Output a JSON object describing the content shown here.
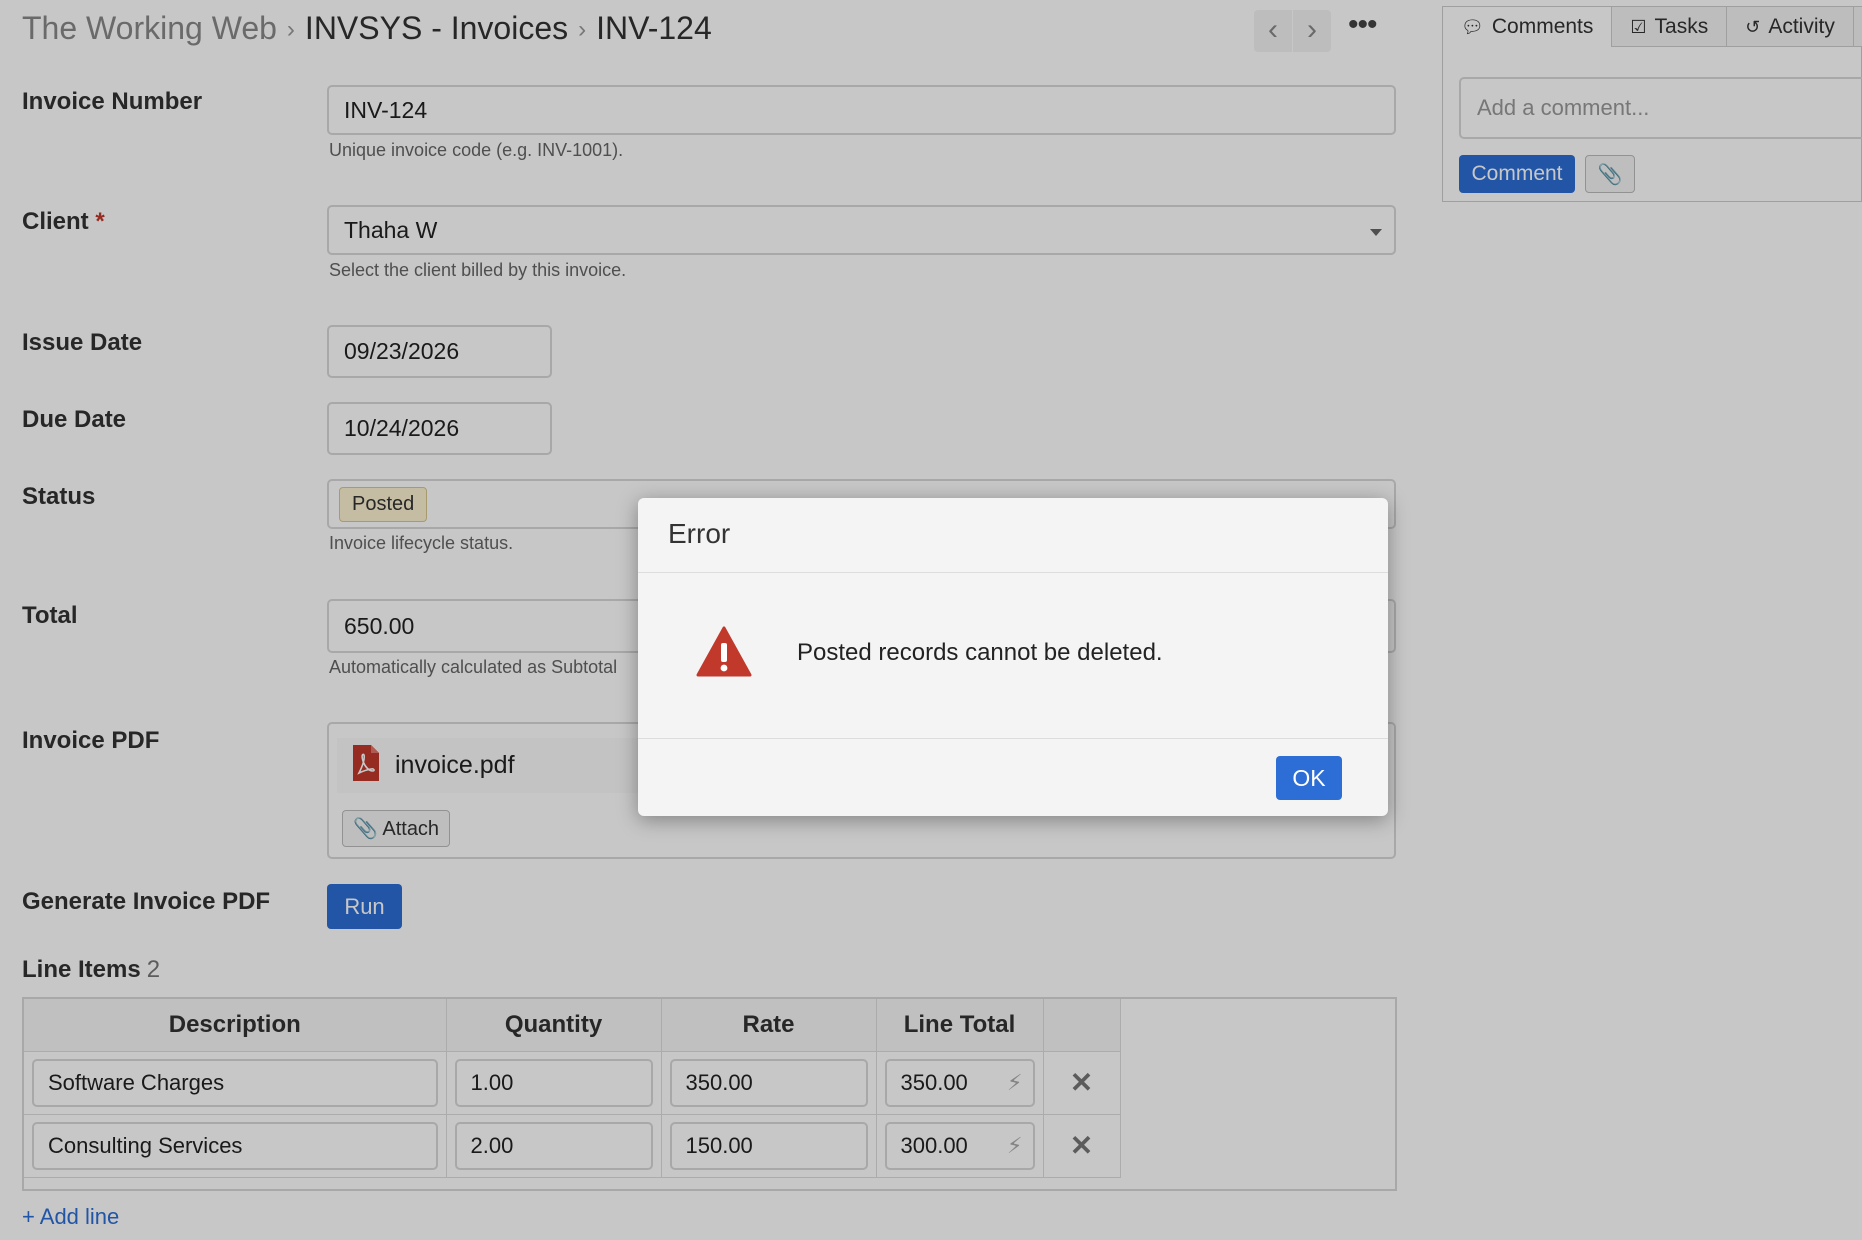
{
  "breadcrumb": {
    "app": "The Working Web",
    "module": "INVSYS - Invoices",
    "record": "INV-124",
    "separator": "›"
  },
  "nav": {
    "prev_glyph": "‹",
    "next_glyph": "›",
    "more_glyph": "•••"
  },
  "form": {
    "invoice_number": {
      "label": "Invoice Number",
      "value": "INV-124",
      "help": "Unique invoice code (e.g. INV-1001)."
    },
    "client": {
      "label": "Client",
      "required_mark": "*",
      "value": "Thaha W",
      "help": "Select the client billed by this invoice."
    },
    "issue_date": {
      "label": "Issue Date",
      "value": "09/23/2026"
    },
    "due_date": {
      "label": "Due Date",
      "value": "10/24/2026"
    },
    "status": {
      "label": "Status",
      "value": "Posted",
      "help": "Invoice lifecycle status."
    },
    "total": {
      "label": "Total",
      "value": "650.00",
      "help": "Automatically calculated as Subtotal"
    },
    "invoice_pdf": {
      "label": "Invoice PDF",
      "file_name": "invoice.pdf",
      "attach_label": "Attach"
    },
    "generate_pdf": {
      "label": "Generate Invoice PDF",
      "button_label": "Run"
    }
  },
  "line_items": {
    "title": "Line Items",
    "count": "2",
    "columns": [
      "Description",
      "Quantity",
      "Rate",
      "Line Total"
    ],
    "rows": [
      {
        "description": "Software Charges",
        "quantity": "1.00",
        "rate": "350.00",
        "line_total": "350.00"
      },
      {
        "description": "Consulting Services",
        "quantity": "2.00",
        "rate": "150.00",
        "line_total": "300.00"
      }
    ],
    "add_line_label": "Add line"
  },
  "side_panel": {
    "tabs": [
      {
        "label": "Comments",
        "icon": "speech-bubble-icon"
      },
      {
        "label": "Tasks",
        "icon": "checkbox-icon"
      },
      {
        "label": "Activity",
        "icon": "history-icon"
      }
    ],
    "comment_placeholder": "Add a comment...",
    "comment_button": "Comment"
  },
  "dialog": {
    "title": "Error",
    "message": "Posted records cannot be deleted.",
    "ok_label": "OK",
    "icon": "warning-triangle-icon"
  },
  "colors": {
    "accent": "#2c6ed5",
    "error_icon": "#c0392b",
    "status_badge_bg": "#fbf3d3"
  }
}
